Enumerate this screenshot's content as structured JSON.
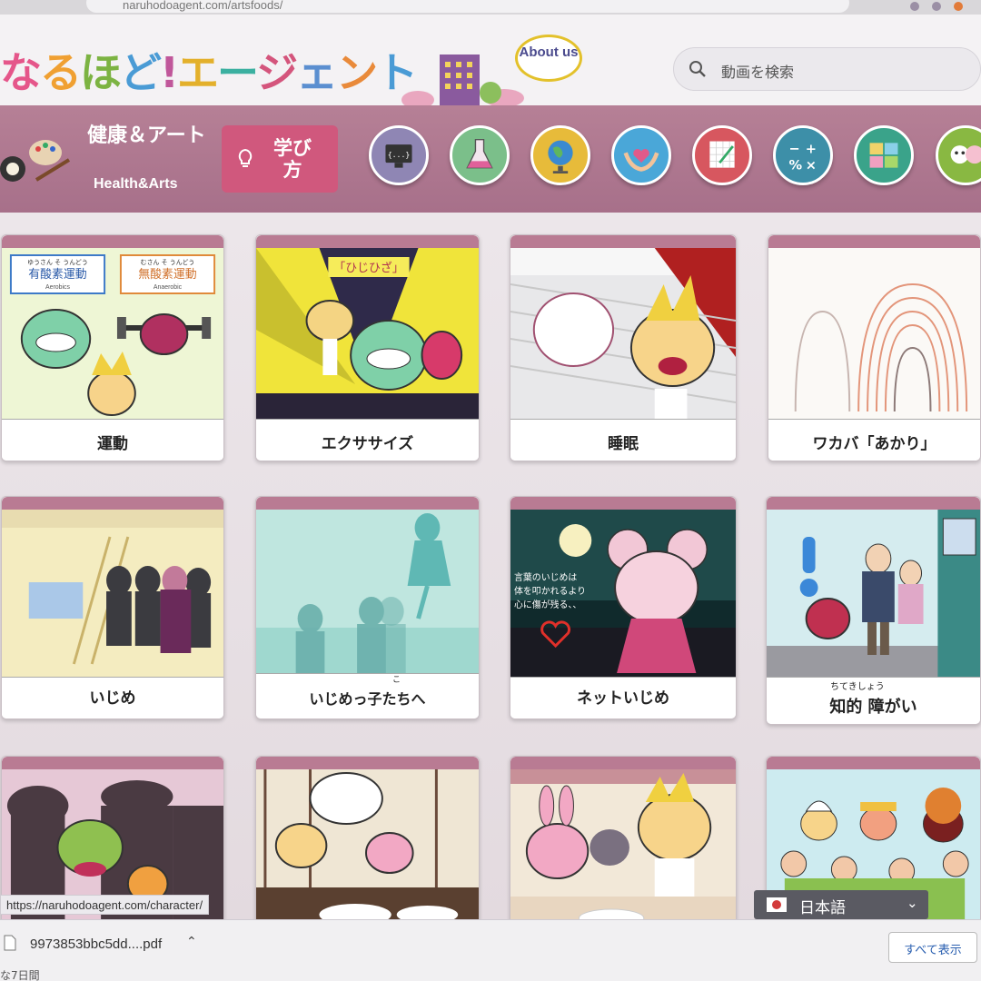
{
  "browser": {
    "url": "naruhodoagent.com/artsfoods/"
  },
  "header": {
    "logo_chars": [
      "な",
      "る",
      "ほ",
      "ど",
      "!",
      "エ",
      "ー",
      "ジ",
      "ェ",
      "ン"
    ],
    "logo_text": "なるほど!エージェント",
    "about_label": "About us",
    "search_placeholder": "動画を検索"
  },
  "nav": {
    "category_jp": "健康＆アート",
    "category_en": "Health&Arts",
    "learn_label": "学び方",
    "category_icons": [
      {
        "name": "computer-icon",
        "color": "#8f86b4"
      },
      {
        "name": "flask-icon",
        "color": "#7bbf8a"
      },
      {
        "name": "globe-icon",
        "color": "#e7bb3a"
      },
      {
        "name": "heart-hands-icon",
        "color": "#4aa7d8"
      },
      {
        "name": "drawing-icon",
        "color": "#d7575f"
      },
      {
        "name": "math-icon",
        "color": "#3d8fa8"
      },
      {
        "name": "puzzle-icon",
        "color": "#3aa38a"
      },
      {
        "name": "characters-icon",
        "color": "#89b842"
      }
    ]
  },
  "videos": [
    {
      "title": "運動",
      "furigana": [
        "ゆうさん そ うんどう",
        "むさん そ うんどう"
      ],
      "labels": [
        "有酸素運動",
        "無酸素運動",
        "Aerobics",
        "Anaerobic"
      ]
    },
    {
      "title": "エクササイズ",
      "labels": [
        "「ひじひざ」"
      ]
    },
    {
      "title": "睡眠"
    },
    {
      "title": "ワカバ「あかり」"
    },
    {
      "title": "いじめ"
    },
    {
      "title": "いじめっ子たちへ",
      "furigana": [
        "こ"
      ]
    },
    {
      "title": "ネットいじめ",
      "labels": [
        "言葉のいじめは",
        "体を叩かれるより",
        "心に傷が残る、、"
      ]
    },
    {
      "title": "知的 障がい",
      "furigana": [
        "ちてきしょう"
      ]
    },
    {
      "title": ""
    },
    {
      "title": ""
    },
    {
      "title": ""
    },
    {
      "title": ""
    }
  ],
  "status_url": "https://naruhodoagent.com/character/",
  "language": {
    "label": "日本語"
  },
  "download": {
    "file_name": "9973853bbc5dd....pdf",
    "sub_text": "な7日間",
    "show_all": "すべて表示"
  }
}
